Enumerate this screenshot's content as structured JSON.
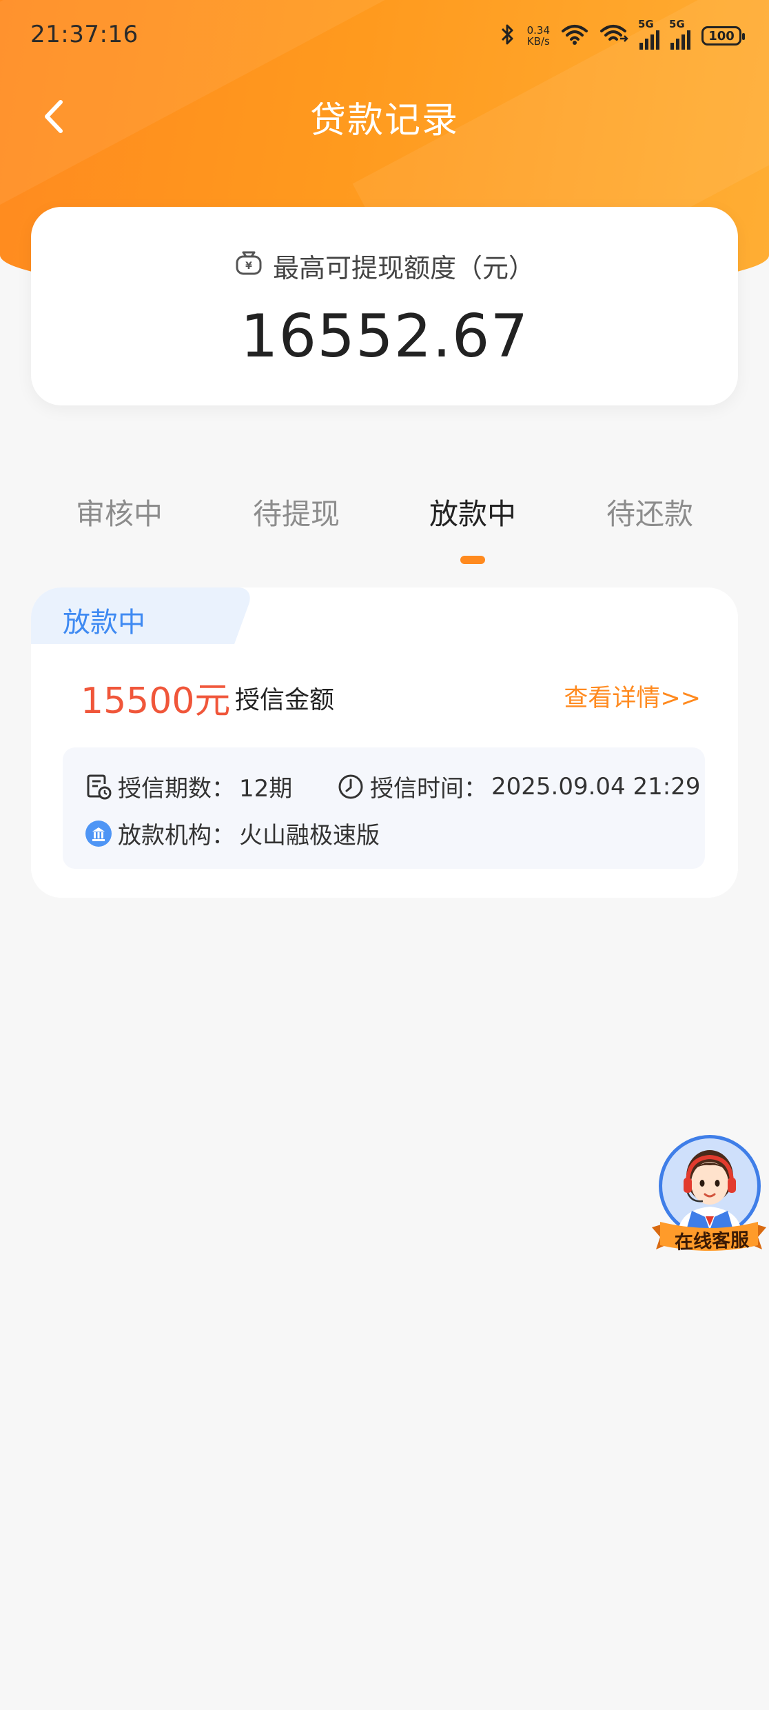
{
  "status_bar": {
    "time": "21:37:16",
    "net_speed_value": "0.34",
    "net_speed_unit": "KB/s",
    "signal_1_label": "5G",
    "signal_2_label": "5G",
    "battery": "100"
  },
  "header": {
    "title": "贷款记录"
  },
  "limit": {
    "label": "最高可提现额度（元）",
    "value": "16552.67"
  },
  "tabs": [
    {
      "label": "审核中",
      "active": false
    },
    {
      "label": "待提现",
      "active": false
    },
    {
      "label": "放款中",
      "active": true
    },
    {
      "label": "待还款",
      "active": false
    }
  ],
  "record": {
    "status_tag": "放款中",
    "amount": "15500元",
    "amount_label": "授信金额",
    "detail_link": "查看详情>>",
    "periods_label": "授信期数：",
    "periods_value": "12期",
    "time_label": "授信时间：",
    "time_value": "2025.09.04 21:29",
    "institution_label": "放款机构：",
    "institution_value": "火山融极速版"
  },
  "customer_service": {
    "label": "在线客服"
  },
  "colors": {
    "brand_orange": "#ff8a1f",
    "amount_red": "#f0563a",
    "tag_blue": "#3f8af2"
  }
}
